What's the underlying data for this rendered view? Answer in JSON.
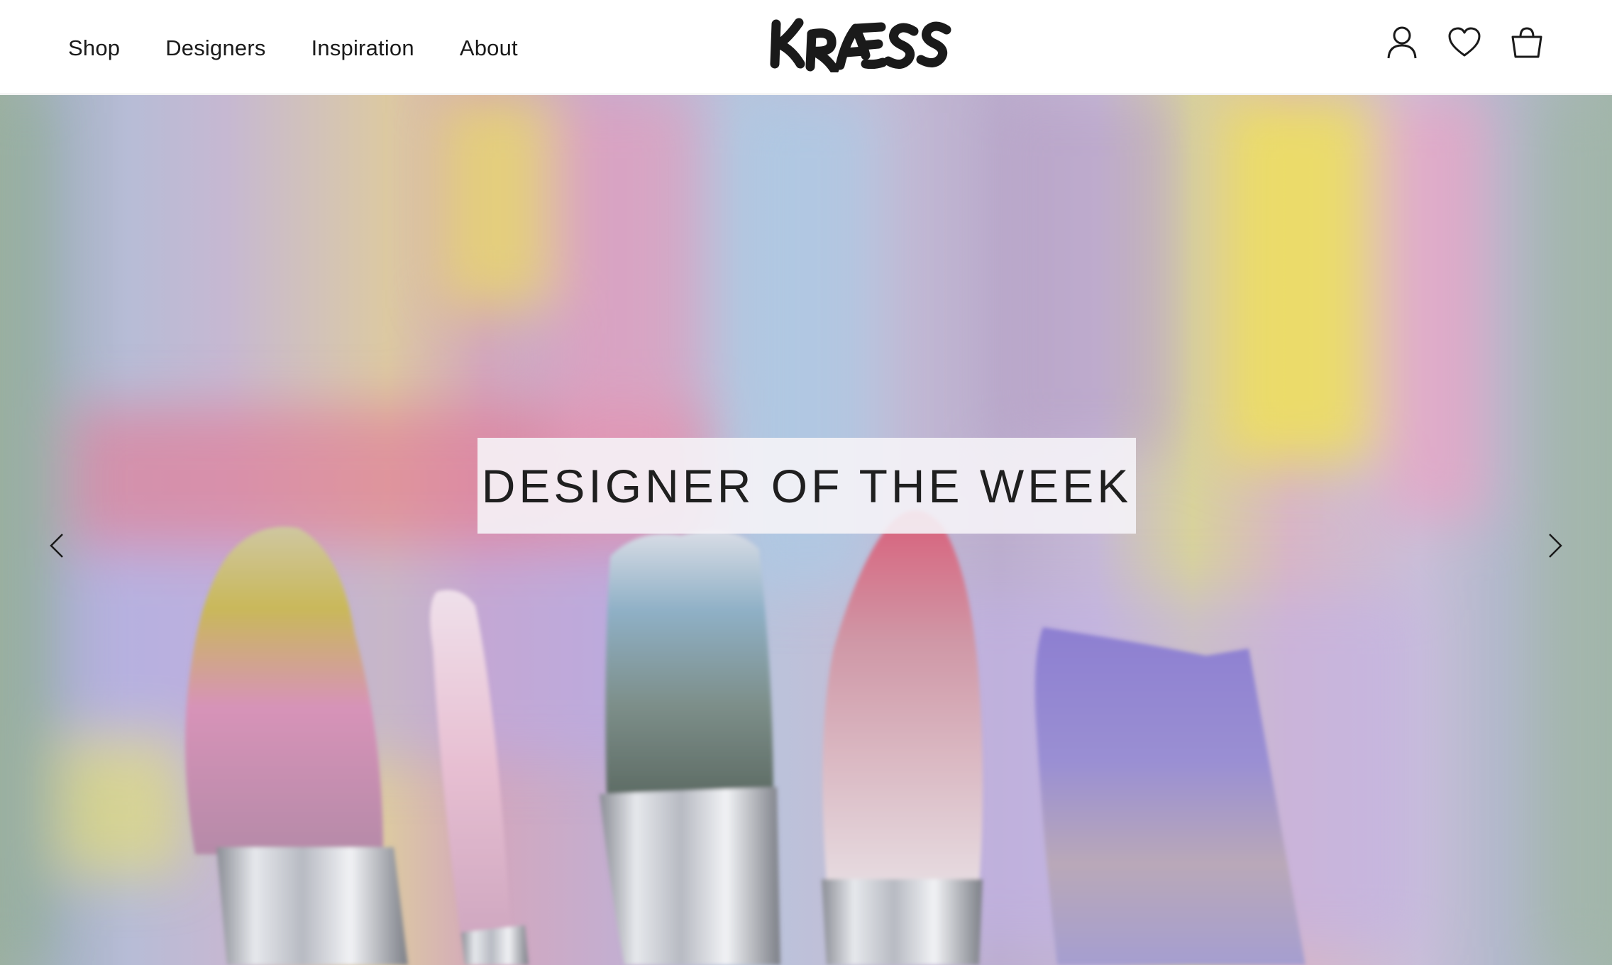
{
  "nav": {
    "items": [
      {
        "label": "Shop"
      },
      {
        "label": "Designers"
      },
      {
        "label": "Inspiration"
      },
      {
        "label": "About"
      }
    ]
  },
  "brand": {
    "name": "KRÆSS",
    "logo_color": "#1a1a1a"
  },
  "header_icons": [
    "user-icon",
    "heart-icon",
    "shopping-bag-icon"
  ],
  "hero": {
    "caption": "DESIGNER OF THE WEEK",
    "image_subject": "paint-brushes"
  },
  "colors": {
    "header_bg": "#ffffff",
    "text": "#1a1a1a",
    "caption_bg": "#f5f3f7"
  }
}
